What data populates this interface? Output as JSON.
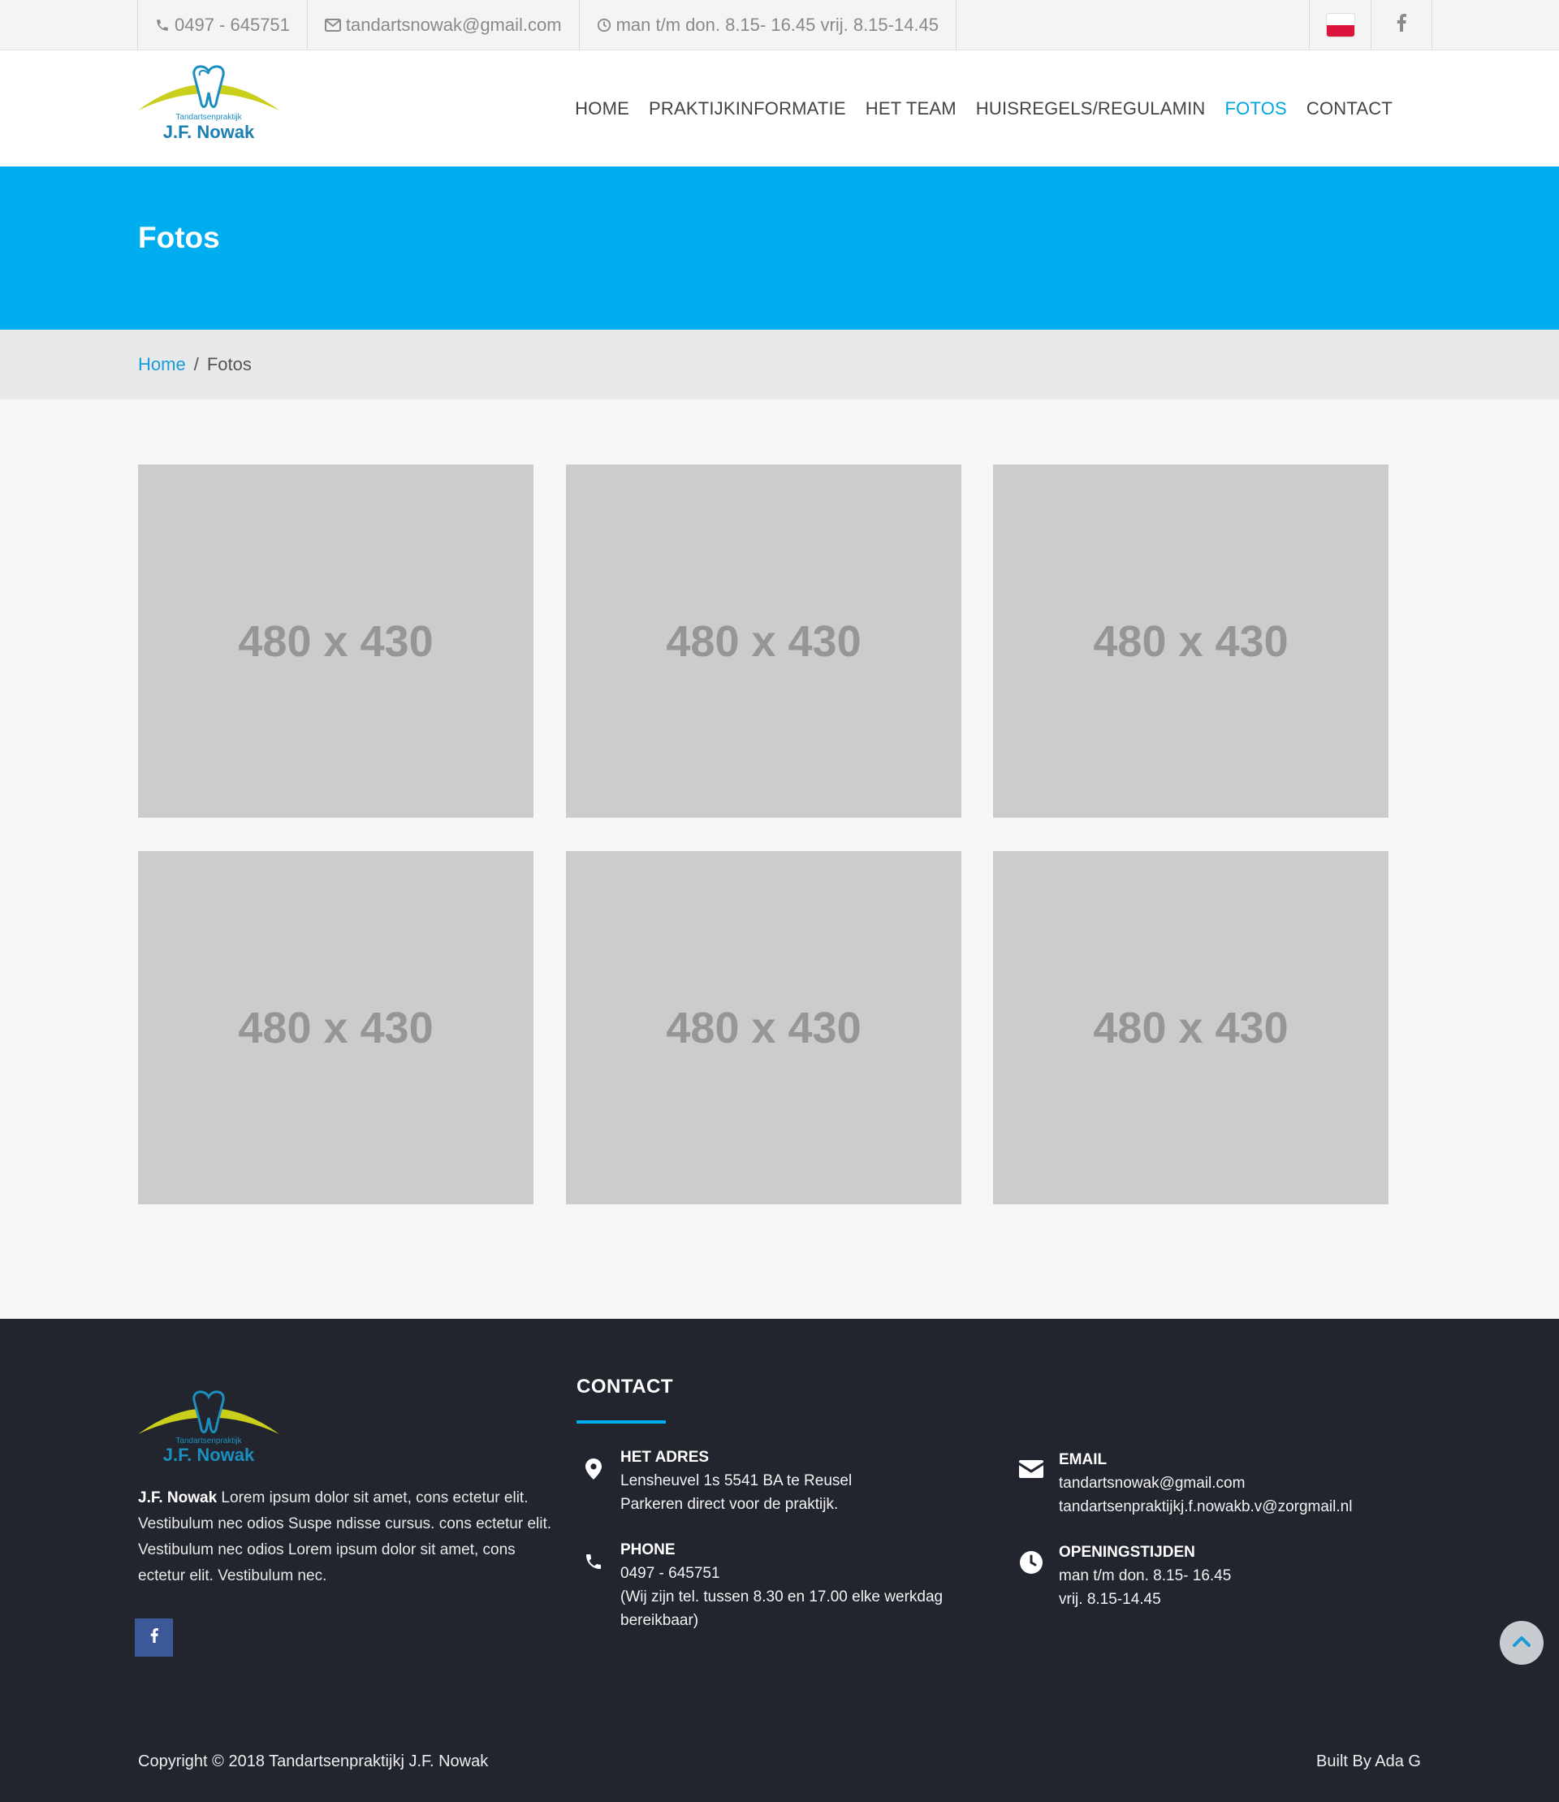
{
  "topbar": {
    "phone": "0497 - 645751",
    "email": "tandartsnowak@gmail.com",
    "hours": "man t/m don. 8.15- 16.45 vrij. 8.15-14.45"
  },
  "logo": {
    "subtitle": "Tandartsenpraktijk",
    "name": "J.F. Nowak"
  },
  "nav": {
    "items": [
      {
        "label": "HOME"
      },
      {
        "label": "PRAKTIJKINFORMATIE"
      },
      {
        "label": "HET TEAM"
      },
      {
        "label": "HUISREGELS/REGULAMIN"
      },
      {
        "label": "FOTOS"
      },
      {
        "label": "CONTACT"
      }
    ],
    "active": "FOTOS"
  },
  "page": {
    "title": "Fotos"
  },
  "breadcrumb": {
    "home": "Home",
    "separator": "/",
    "current": "Fotos"
  },
  "gallery": {
    "tiles": [
      "480 x 430",
      "480 x 430",
      "480 x 430",
      "480 x 430",
      "480 x 430",
      "480 x 430"
    ]
  },
  "footer": {
    "about_name": "J.F. Nowak",
    "about_text": " Lorem ipsum dolor sit amet, cons ectetur elit. Vestibulum nec odios Suspe ndisse cursus. cons ectetur elit. Vestibulum nec odios Lorem ipsum dolor sit amet, cons ectetur elit. Vestibulum nec.",
    "contact_title": "CONTACT",
    "address": {
      "label": "HET ADRES",
      "line1": "Lensheuvel 1s 5541 BA te Reusel",
      "line2": "Parkeren direct voor de praktijk."
    },
    "phone": {
      "label": "PHONE",
      "line1": "0497 - 645751",
      "line2": "(Wij zijn tel. tussen 8.30 en 17.00 elke werkdag",
      "line3": "bereikbaar)"
    },
    "email": {
      "label": "EMAIL",
      "line1": "tandartsnowak@gmail.com",
      "line2": "tandartsenpraktijkj.f.nowakb.v@zorgmail.nl"
    },
    "hours": {
      "label": "OPENINGSTIJDEN",
      "line1": "man t/m don. 8.15- 16.45",
      "line2": "vrij. 8.15-14.45"
    },
    "copyright": "Copyright © 2018 Tandartsenpraktijkj J.F. Nowak",
    "built_by": "Built By Ada G"
  },
  "colors": {
    "accent": "#00aeef",
    "footer_bg": "#22252d",
    "placeholder": "#cccccc",
    "facebook": "#3b5998"
  },
  "icons": [
    "phone-icon",
    "envelope-icon",
    "clock-icon",
    "polish-flag-icon",
    "facebook-icon",
    "map-pin-icon",
    "chevron-up-icon"
  ]
}
